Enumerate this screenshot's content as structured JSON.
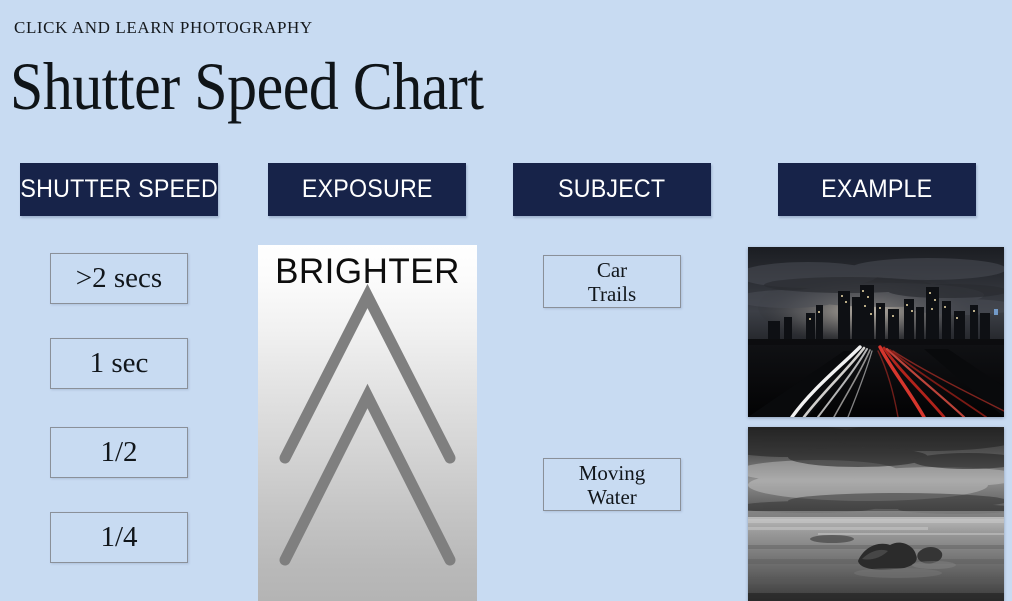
{
  "header": {
    "kicker": "CLICK AND LEARN PHOTOGRAPHY",
    "title": "Shutter Speed Chart"
  },
  "colors": {
    "page_background": "#c8dbf2",
    "header_chip": "#172349",
    "header_chip_text": "#ffffff",
    "box_border": "#8a9099",
    "chevron": "#7f7f7f",
    "gradient_top": "#ffffff",
    "gradient_bottom": "#b4b4b4"
  },
  "columns": [
    {
      "label": "SHUTTER SPEED"
    },
    {
      "label": "EXPOSURE"
    },
    {
      "label": "SUBJECT"
    },
    {
      "label": "EXAMPLE"
    }
  ],
  "shutter_speeds": [
    {
      "value": ">2 secs"
    },
    {
      "value": "1 sec"
    },
    {
      "value": "1/2"
    },
    {
      "value": "1/4"
    }
  ],
  "exposure": {
    "label": "BRIGHTER",
    "direction_icon": "double-chevron-up-icon"
  },
  "subjects": [
    {
      "line1": "Car",
      "line2": "Trails"
    },
    {
      "line1": "Moving",
      "line2": "Water"
    }
  ],
  "examples": [
    {
      "alt": "night-city-light-trails-photo"
    },
    {
      "alt": "long-exposure-seascape-photo"
    }
  ]
}
